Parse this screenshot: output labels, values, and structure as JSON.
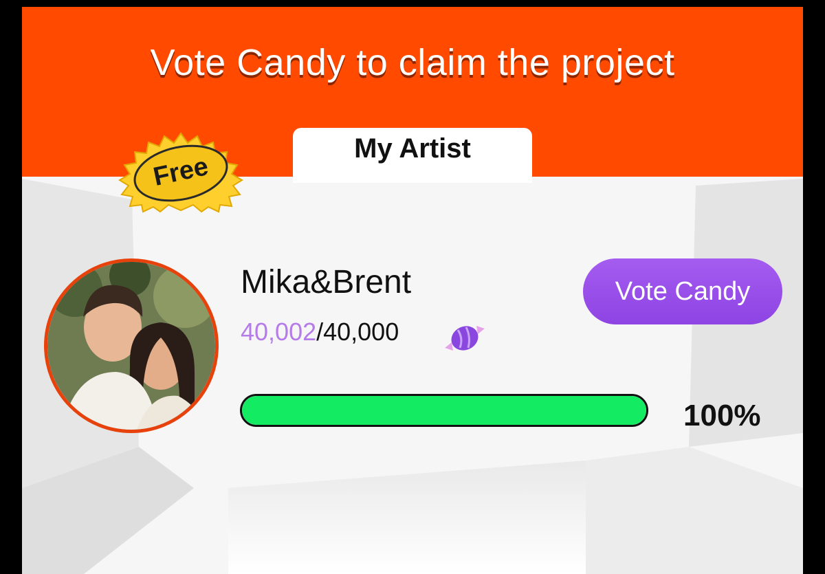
{
  "banner": {
    "title": "Vote Candy to claim the project"
  },
  "tabs": {
    "active_label": "My Artist"
  },
  "badge": {
    "label": "Free"
  },
  "artist": {
    "name": "Mika&Brent",
    "current_votes": "40,002",
    "goal_votes": "/40,000",
    "vote_button_label": "Vote Candy",
    "progress": {
      "percent": 100,
      "label": "100%"
    }
  },
  "colors": {
    "banner": "#ff4a00",
    "button": "#9b51e8",
    "progress_fill": "#13eb62",
    "current_votes": "#b57be8"
  },
  "icons": {
    "candy": "candy-icon",
    "badge": "starburst-badge-icon"
  }
}
